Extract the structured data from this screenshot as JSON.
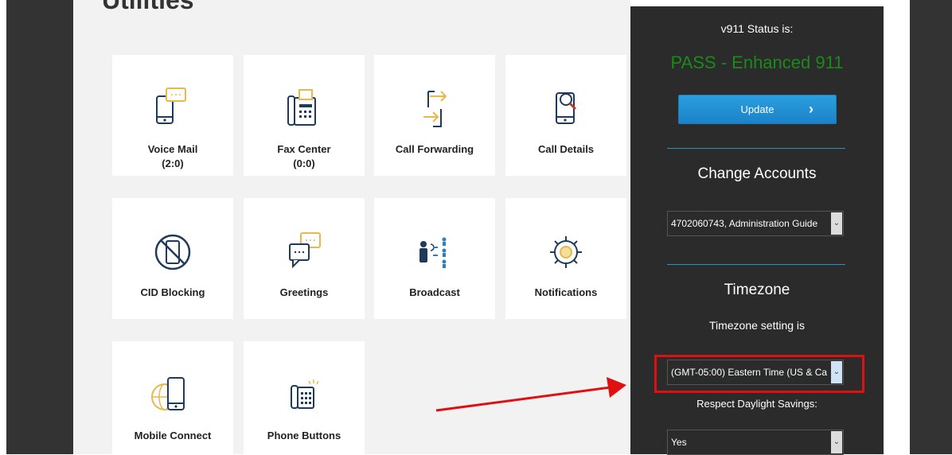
{
  "page": {
    "title": "Utilities"
  },
  "tiles": [
    {
      "label": "Voice Mail",
      "sub": "(2:0)",
      "icon": "voicemail-phone-icon"
    },
    {
      "label": "Fax Center",
      "sub": "(0:0)",
      "icon": "fax-machine-icon"
    },
    {
      "label": "Call Forwarding",
      "sub": "",
      "icon": "call-forwarding-icon"
    },
    {
      "label": "Call Details",
      "sub": "",
      "icon": "call-details-magnifier-icon"
    },
    {
      "label": "CID Blocking",
      "sub": "",
      "icon": "cid-blocked-phone-icon"
    },
    {
      "label": "Greetings",
      "sub": "",
      "icon": "greetings-chat-bubbles-icon"
    },
    {
      "label": "Broadcast",
      "sub": "",
      "icon": "broadcast-people-icon"
    },
    {
      "label": "Notifications",
      "sub": "",
      "icon": "notifications-gear-icon"
    },
    {
      "label": "Mobile Connect",
      "sub": "",
      "icon": "mobile-connect-globe-icon"
    },
    {
      "label": "Phone Buttons",
      "sub": "",
      "icon": "phone-buttons-icon"
    }
  ],
  "sidebar": {
    "v911_label": "v911 Status is:",
    "v911_status": "PASS - Enhanced 911",
    "update_label": "Update",
    "update_chevron": "›",
    "accounts_title": "Change Accounts",
    "account_selected": "4702060743, Administration Guide",
    "timezone_title": "Timezone",
    "timezone_setting_label": "Timezone setting is",
    "timezone_selected": "(GMT-05:00) Eastern Time (US & Ca",
    "daylight_label": "Respect Daylight Savings:",
    "daylight_selected": "Yes",
    "caret": "⌄"
  },
  "colors": {
    "accent_blue": "#1c82c8",
    "status_green": "#1a8a1a",
    "highlight_red": "#e01010",
    "icon_navy": "#1f3a5a",
    "icon_gold": "#e8b84a"
  }
}
